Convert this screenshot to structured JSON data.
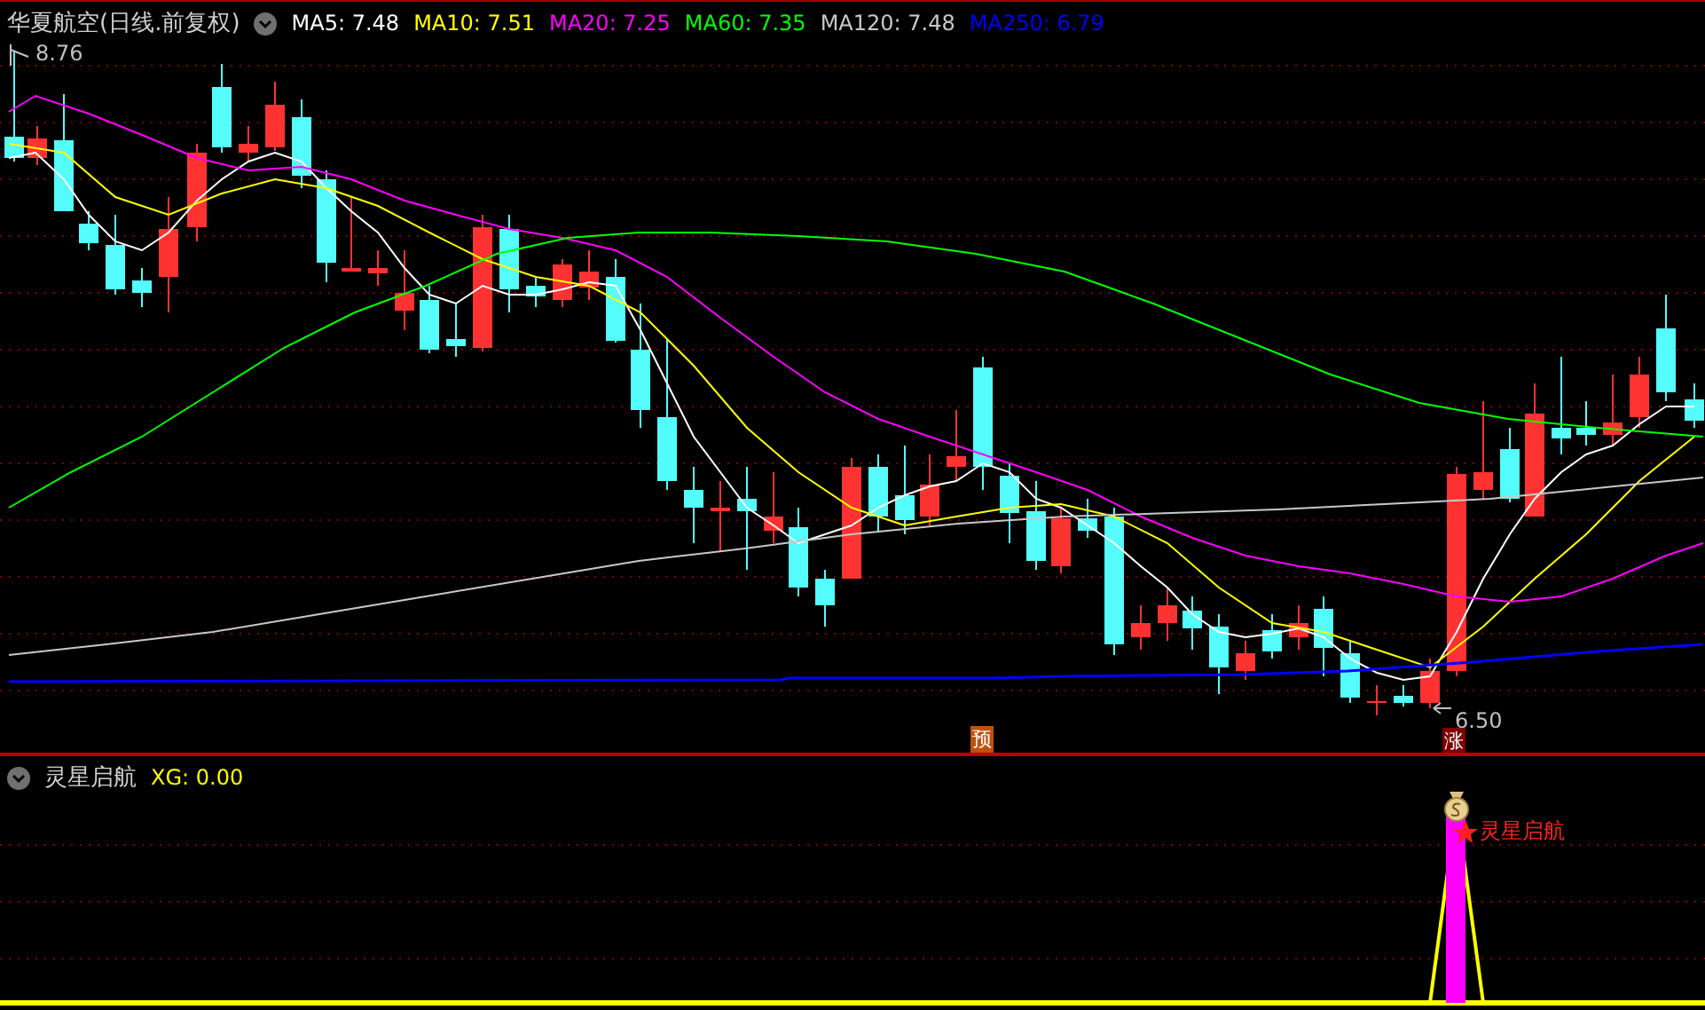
{
  "header": {
    "title": "华夏航空(日线.前复权)",
    "indicators": [
      {
        "label": "MA5: 7.48",
        "color": "#ffffff"
      },
      {
        "label": "MA10: 7.51",
        "color": "#ffff00"
      },
      {
        "label": "MA20: 7.25",
        "color": "#ff00ff"
      },
      {
        "label": "MA60: 7.35",
        "color": "#00ff00"
      },
      {
        "label": "MA120: 7.48",
        "color": "#c8c8c8"
      },
      {
        "label": "MA250: 6.79",
        "color": "#0000ff"
      }
    ]
  },
  "price_labels": {
    "high": "8.76",
    "low": "6.50"
  },
  "signals": [
    {
      "label": "预",
      "kind": "forecast"
    },
    {
      "label": "涨",
      "kind": "rise"
    }
  ],
  "sub_panel": {
    "title": "灵星启航",
    "reading": "XG: 0.00",
    "marker_label": "灵星启航"
  }
}
